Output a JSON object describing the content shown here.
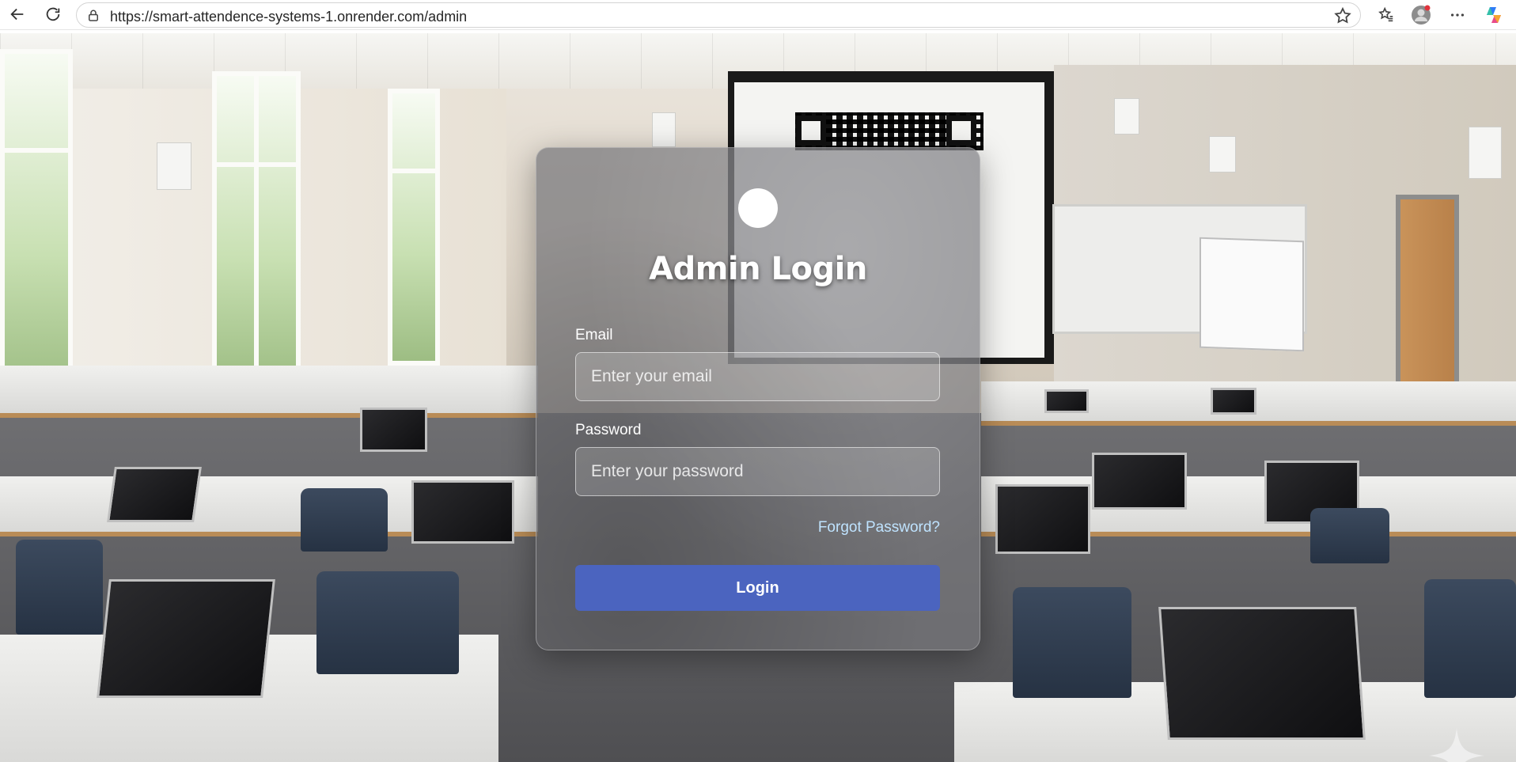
{
  "browser": {
    "url": "https://smart-attendence-systems-1.onrender.com/admin",
    "icons": [
      "back-arrow-icon",
      "refresh-icon",
      "lock-icon",
      "star-icon",
      "favorites-icon",
      "profile-icon",
      "more-icon",
      "copilot-icon"
    ]
  },
  "login": {
    "title": "Admin Login",
    "email_label": "Email",
    "email_placeholder": "Enter your email",
    "password_label": "Password",
    "password_placeholder": "Enter your password",
    "forgot_label": "Forgot Password?",
    "login_label": "Login"
  },
  "colors": {
    "button": "#4b64bf",
    "link": "#bfe3ff"
  }
}
